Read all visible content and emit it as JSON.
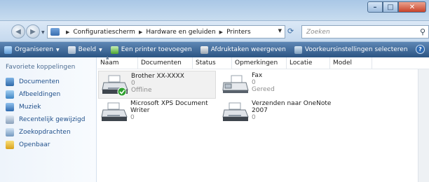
{
  "window": {
    "controls": {
      "minimize": "–",
      "maximize": "□",
      "close": "✕"
    }
  },
  "address_bar": {
    "breadcrumbs": [
      "Configuratiescherm",
      "Hardware en geluiden",
      "Printers"
    ],
    "search_placeholder": "Zoeken"
  },
  "toolbar": {
    "organize": "Organiseren",
    "view": "Beeld",
    "add_printer": "Een printer toevoegen",
    "print_queue": "Afdruktaken weergeven",
    "preferences": "Voorkeursinstellingen selecteren",
    "more": "»",
    "help": "?"
  },
  "navigation_pane": {
    "title": "Favoriete koppelingen",
    "items": [
      {
        "label": "Documenten",
        "icon": "documents-icon"
      },
      {
        "label": "Afbeeldingen",
        "icon": "pictures-icon"
      },
      {
        "label": "Muziek",
        "icon": "music-icon"
      },
      {
        "label": "Recentelijk gewijzigd",
        "icon": "recent-icon"
      },
      {
        "label": "Zoekopdrachten",
        "icon": "searches-icon"
      },
      {
        "label": "Openbaar",
        "icon": "public-folder-icon"
      }
    ]
  },
  "columns": [
    "Naam",
    "Documenten",
    "Status",
    "Opmerkingen",
    "Locatie",
    "Model"
  ],
  "printers": [
    {
      "name": "Brother XX-XXXX",
      "documents": "0",
      "status": "Offline",
      "icon": "printer-icon",
      "default": true,
      "selected": true
    },
    {
      "name": "Fax",
      "documents": "0",
      "status": "Gereed",
      "icon": "fax-icon"
    },
    {
      "name_line1": "Microsoft XPS Document",
      "name_line2": "Writer",
      "documents": "0",
      "icon": "printer-icon"
    },
    {
      "name_line1": "Verzenden naar OneNote",
      "name_line2": "2007",
      "documents": "0",
      "icon": "printer-icon"
    }
  ],
  "colors": {
    "toolbar": "#2b5483",
    "link": "#1f4f8a",
    "default_check": "#2fa12f"
  }
}
